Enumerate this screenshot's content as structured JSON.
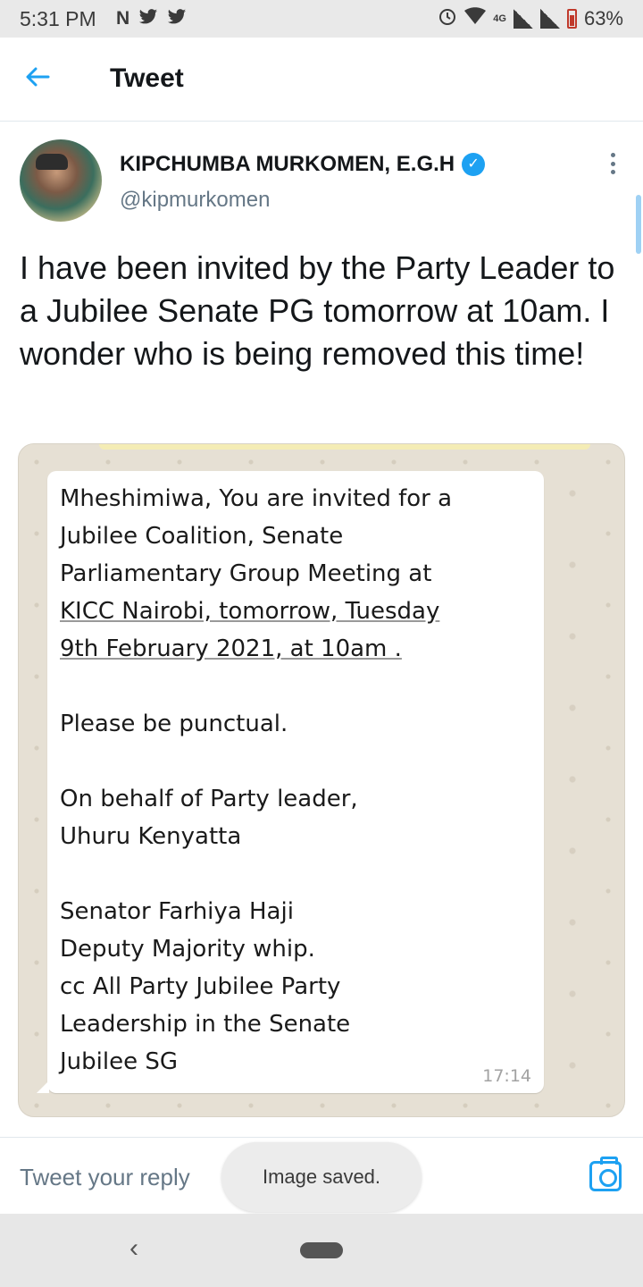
{
  "status_bar": {
    "time": "5:31 PM",
    "left_icons": [
      "N",
      "twitter-bird-icon",
      "twitter-bird-icon"
    ],
    "network": "4G",
    "battery": "63%"
  },
  "header": {
    "back_icon": "arrow-left-icon",
    "title": "Tweet"
  },
  "tweet": {
    "author_name": "KIPCHUMBA MURKOMEN, E.G.H",
    "handle": "@kipmurkomen",
    "text": "I have been invited by the Party Leader to a Jubilee Senate PG tomorrow at 10am. I wonder who is being removed this time!",
    "media": {
      "message_lines": [
        "Mheshimiwa, You are invited  for a",
        "Jubilee Coalition, Senate",
        "Parliamentary Group Meeting at",
        "KICC Nairobi, tomorrow, Tuesday",
        "9th February 2021, at 10am .",
        "",
        "Please be punctual.",
        "",
        "On behalf of Party leader,",
        "Uhuru Kenyatta",
        "",
        "Senator Farhiya Haji",
        "Deputy Majority whip.",
        "cc All Party Jubilee Party",
        "Leadership in the Senate",
        "Jubilee SG"
      ],
      "time": "17:14"
    }
  },
  "reply": {
    "placeholder": "Tweet your reply"
  },
  "toast": {
    "text": "Image saved."
  },
  "nav": {
    "back": "‹"
  }
}
